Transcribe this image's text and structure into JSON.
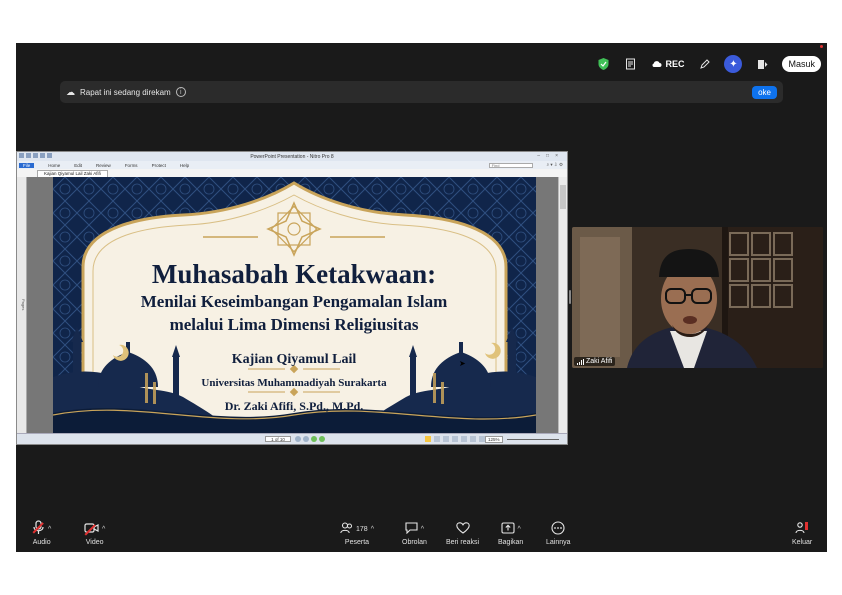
{
  "topbar": {
    "rec_label": "REC",
    "signin_label": "Masuk",
    "icons": [
      "shield-icon",
      "notes-icon",
      "cloud-record-icon",
      "pen-icon",
      "ai-companion-icon",
      "apps-icon"
    ]
  },
  "banner": {
    "text": "Rapat ini sedang direkam",
    "ok_label": "oke"
  },
  "shared_screen": {
    "window_title": "PowerPoint Presentation - Nitro Pro 8",
    "menu": [
      "File",
      "Home",
      "Edit",
      "Review",
      "Forms",
      "Protect",
      "Help"
    ],
    "find_placeholder": "Find",
    "tab_label": "Kajian Qiyamul Lail Zaki Afifi",
    "pages_label": "Pages",
    "page_indicator": "1 of 10",
    "zoom": "125%",
    "slide": {
      "title": "Muhasabah Ketakwaan:",
      "subtitle_line1": "Menilai Keseimbangan Pengamalan Islam",
      "subtitle_line2": "melalui Lima Dimensi Religiusitas",
      "event": "Kajian Qiyamul Lail",
      "institution": "Universitas Muhammadiyah Surakarta",
      "speaker": "Dr. Zaki Afifi, S.Pd., M.Pd."
    }
  },
  "participant": {
    "name": "Zaki Afifi"
  },
  "toolbar": {
    "audio_label": "Audio",
    "video_label": "Video",
    "participants_label": "Peserta",
    "participants_count": "178",
    "chat_label": "Obrolan",
    "react_label": "Beri reaksi",
    "share_label": "Bagikan",
    "more_label": "Lainnya",
    "leave_label": "Keluar"
  },
  "colors": {
    "app_bg": "#1a1a1a",
    "accent_blue": "#0e72ed",
    "slide_navy": "#0f1f3a",
    "slide_cream": "#f7f1e4",
    "gold": "#c9a45a",
    "muted_red": "#e03131"
  }
}
